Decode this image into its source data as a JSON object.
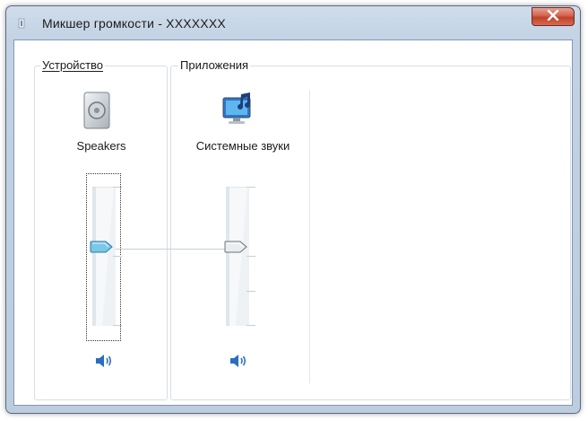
{
  "window": {
    "title": "Микшер громкости - ",
    "title_suffix": "XXXXXXX",
    "close_icon": "close-icon"
  },
  "groups": {
    "device_label": "Устройство",
    "apps_label": "Приложения"
  },
  "device": {
    "name": "Speakers",
    "icon": "speaker-device-icon",
    "volume": 0.57,
    "mute_icon": "speaker-volume-icon"
  },
  "apps": [
    {
      "name": "Системные звуки",
      "icon": "system-sounds-icon",
      "volume": 0.57,
      "mute_icon": "speaker-volume-icon"
    }
  ],
  "colors": {
    "accent_thumb": "#7ac8e8",
    "close_red": "#c2412b",
    "speaker_blue": "#2a6ec0"
  }
}
